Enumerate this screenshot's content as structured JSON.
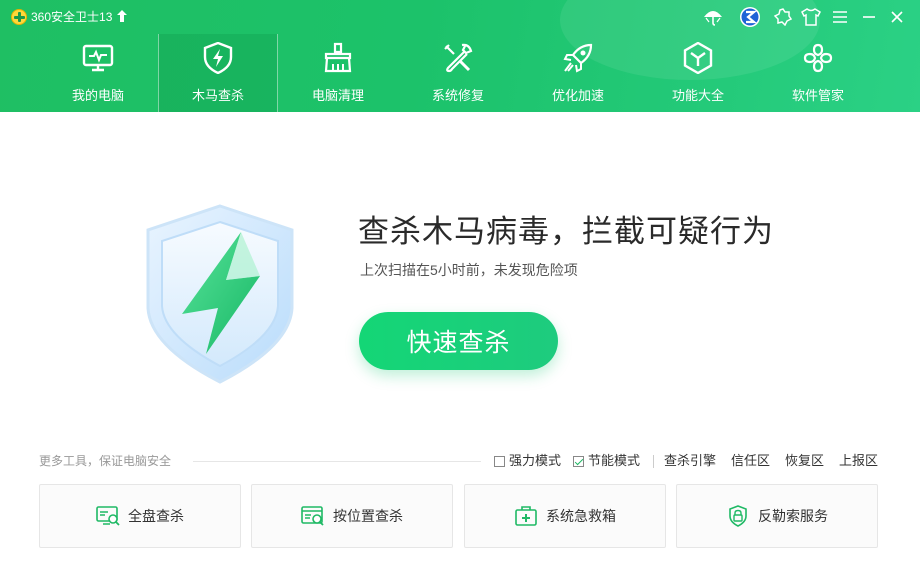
{
  "app": {
    "title": "360安全卫士13"
  },
  "colors": {
    "brand_green": "#1fbf63",
    "button_green": "#14d676",
    "text_dark": "#2a2a2a"
  },
  "titlebar_icons": [
    "umbrella-icon",
    "browser-icon",
    "skin-icon",
    "shirt-icon",
    "menu-icon",
    "minimize-icon",
    "close-icon"
  ],
  "nav": {
    "items": [
      {
        "label": "我的电脑",
        "icon": "monitor-icon"
      },
      {
        "label": "木马查杀",
        "icon": "shield-bolt-icon",
        "active": true
      },
      {
        "label": "电脑清理",
        "icon": "broom-icon"
      },
      {
        "label": "系统修复",
        "icon": "wrench-icon"
      },
      {
        "label": "优化加速",
        "icon": "rocket-icon"
      },
      {
        "label": "功能大全",
        "icon": "hexagon-icon"
      },
      {
        "label": "软件管家",
        "icon": "apps-icon"
      }
    ]
  },
  "main": {
    "headline": "查杀木马病毒，拦截可疑行为",
    "subline": "上次扫描在5小时前，未发现危险项",
    "quick_scan_label": "快速查杀"
  },
  "tools": {
    "section_label": "更多工具，保证电脑安全",
    "options": [
      {
        "label": "强力模式",
        "checked": false
      },
      {
        "label": "节能模式",
        "checked": true
      }
    ],
    "links": [
      "查杀引擎",
      "信任区",
      "恢复区",
      "上报区"
    ],
    "cards": [
      {
        "label": "全盘查杀",
        "icon": "full-scan-icon"
      },
      {
        "label": "按位置查杀",
        "icon": "location-scan-icon"
      },
      {
        "label": "系统急救箱",
        "icon": "first-aid-icon"
      },
      {
        "label": "反勒索服务",
        "icon": "anti-ransom-icon"
      }
    ]
  }
}
